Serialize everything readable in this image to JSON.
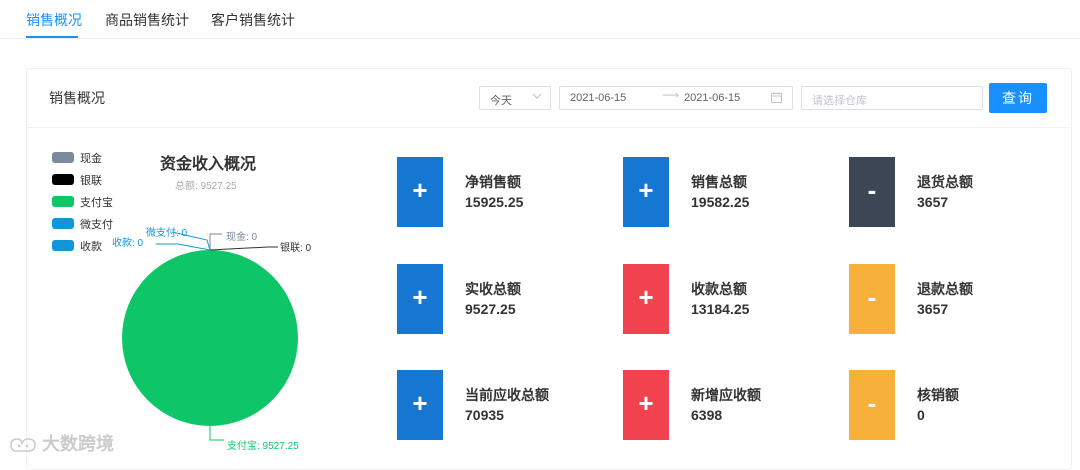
{
  "tabs": [
    {
      "label": "销售概况",
      "active": true
    },
    {
      "label": "商品销售统计",
      "active": false
    },
    {
      "label": "客户销售统计",
      "active": false
    }
  ],
  "card": {
    "title": "销售概况",
    "day_select": "今天",
    "date_start": "2021-06-15",
    "date_end": "2021-06-15",
    "warehouse_placeholder": "请选择仓库",
    "query_label": "查询"
  },
  "legend": [
    {
      "label": "现金",
      "color": "#7c8a9e"
    },
    {
      "label": "银联",
      "color": "#000000"
    },
    {
      "label": "支付宝",
      "color": "#0ec568"
    },
    {
      "label": "微支付",
      "color": "#1296db"
    },
    {
      "label": "收款",
      "color": "#1296db"
    }
  ],
  "chart_data": {
    "type": "pie",
    "title": "资金收入概况",
    "subtitle": "总额: 9527.25",
    "slices": [
      {
        "label": "现金",
        "value": 0,
        "color": "#7c8a9e"
      },
      {
        "label": "银联",
        "value": 0,
        "color": "#000000"
      },
      {
        "label": "支付宝",
        "value": 9527.25,
        "color": "#0ec568"
      },
      {
        "label": "微支付",
        "value": 0,
        "color": "#1296db"
      },
      {
        "label": "收款",
        "value": 0,
        "color": "#1296db"
      }
    ],
    "data_labels": {
      "weizhifu": "微支付: 0",
      "shoukuan": "收款: 0",
      "xianjin": "现金: 0",
      "yinlian": "银联: 0",
      "zhifubao": "支付宝: 9527.25"
    }
  },
  "stats": [
    {
      "sign": "+",
      "label": "净销售额",
      "value": "15925.25",
      "color": "#1677d2"
    },
    {
      "sign": "+",
      "label": "销售总额",
      "value": "19582.25",
      "color": "#1677d2"
    },
    {
      "sign": "-",
      "label": "退货总额",
      "value": "3657",
      "color": "#3c4654"
    },
    {
      "sign": "+",
      "label": "实收总额",
      "value": "9527.25",
      "color": "#1677d2"
    },
    {
      "sign": "+",
      "label": "收款总额",
      "value": "13184.25",
      "color": "#f2414f"
    },
    {
      "sign": "-",
      "label": "退款总额",
      "value": "3657",
      "color": "#f7b03a"
    },
    {
      "sign": "+",
      "label": "当前应收总额",
      "value": "70935",
      "color": "#1677d2"
    },
    {
      "sign": "+",
      "label": "新增应收额",
      "value": "6398",
      "color": "#f2414f"
    },
    {
      "sign": "-",
      "label": "核销额",
      "value": "0",
      "color": "#f7b03a"
    }
  ],
  "watermark": "大数跨境"
}
